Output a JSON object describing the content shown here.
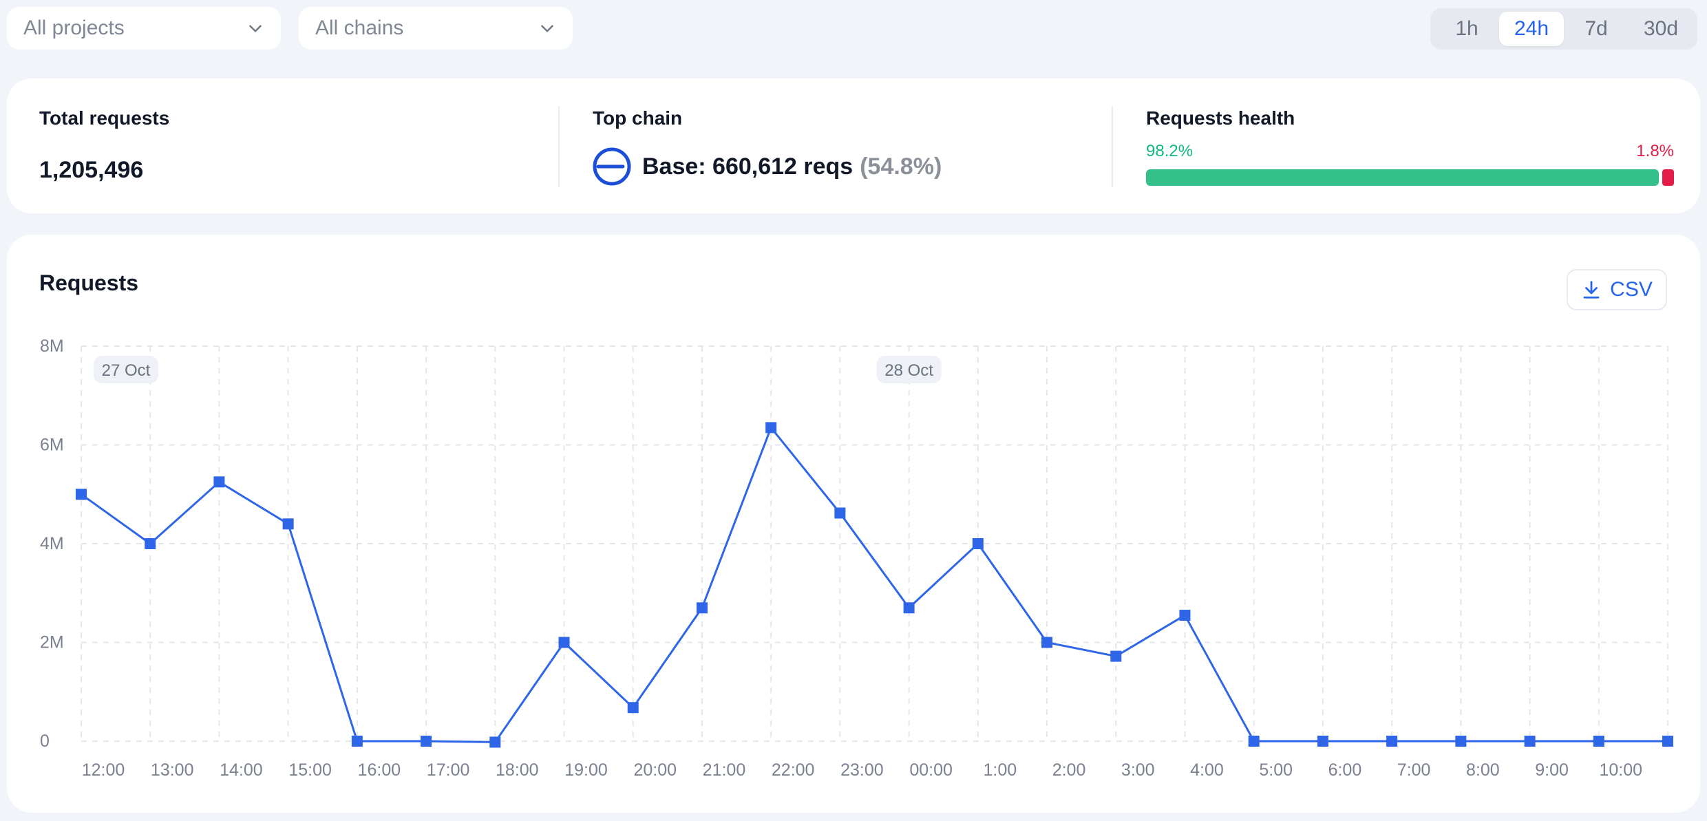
{
  "filters": {
    "projects": "All projects",
    "chains": "All chains"
  },
  "time_ranges": [
    {
      "label": "1h",
      "active": false
    },
    {
      "label": "24h",
      "active": true
    },
    {
      "label": "7d",
      "active": false
    },
    {
      "label": "30d",
      "active": false
    }
  ],
  "stats": {
    "total_requests_label": "Total requests",
    "total_requests_value": "1,205,496",
    "top_chain_label": "Top chain",
    "top_chain_text": "Base: 660,612 reqs",
    "top_chain_pct": "(54.8%)",
    "health_label": "Requests health",
    "health_ok_pct": "98.2%",
    "health_err_pct": "1.8%",
    "health_ok_fraction": 0.982
  },
  "chart_card": {
    "title": "Requests",
    "csv_label": "CSV"
  },
  "colors": {
    "accent": "#2563eb",
    "line": "#2f66e8",
    "health_ok": "#34c08a",
    "health_err": "#e11d48"
  },
  "chart_data": {
    "type": "line",
    "x": [
      "12:00",
      "13:00",
      "14:00",
      "15:00",
      "16:00",
      "17:00",
      "18:00",
      "19:00",
      "20:00",
      "21:00",
      "22:00",
      "23:00",
      "00:00",
      "1:00",
      "2:00",
      "3:00",
      "4:00",
      "5:00",
      "6:00",
      "7:00",
      "8:00",
      "9:00",
      "10:00",
      ""
    ],
    "series": [
      {
        "values": [
          5000000,
          4000000,
          5250000,
          4400000,
          0,
          0,
          -20000,
          2000000,
          680000,
          2700000,
          6350000,
          4620000,
          2700000,
          4000000,
          2000000,
          1720000,
          2550000,
          0,
          0,
          0,
          0,
          0,
          0,
          0
        ]
      }
    ],
    "ylim": [
      0,
      8000000
    ],
    "yticks": [
      0,
      2000000,
      4000000,
      6000000,
      8000000
    ],
    "ytick_labels": [
      "0",
      "2M",
      "4M",
      "6M",
      "8M"
    ],
    "date_annotations": [
      {
        "label": "27 Oct",
        "x_index": 0
      },
      {
        "label": "28 Oct",
        "x_index": 12
      }
    ],
    "grid": true,
    "title": "Requests",
    "xlabel": "",
    "ylabel": ""
  }
}
